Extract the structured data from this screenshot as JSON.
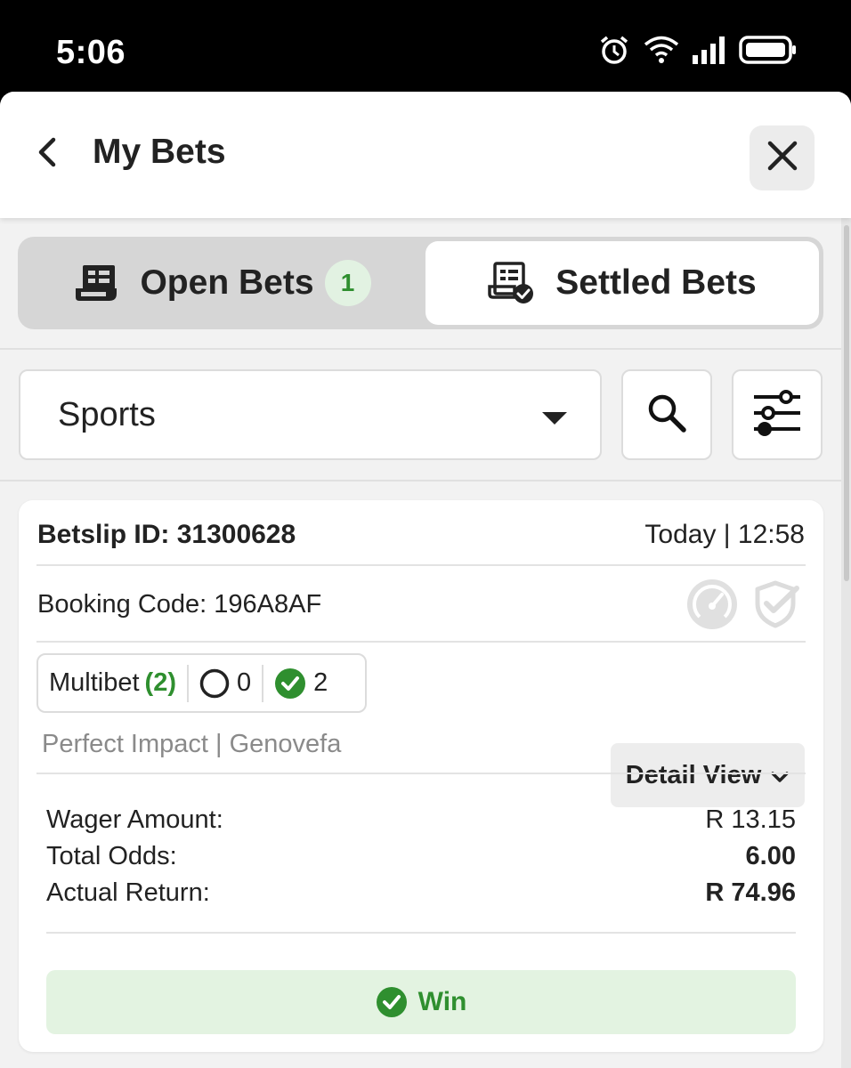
{
  "status_bar": {
    "time": "5:06",
    "icons": [
      "alarm-icon",
      "wifi-icon",
      "signal-icon",
      "battery-icon"
    ]
  },
  "header": {
    "title": "My Bets",
    "back_icon": "chevron-left-icon",
    "close_icon": "close-icon"
  },
  "tabs": [
    {
      "label": "Open Bets",
      "badge": "1",
      "icon": "receipt-icon",
      "active": false
    },
    {
      "label": "Settled Bets",
      "icon": "receipt-check-icon",
      "active": true
    }
  ],
  "filters": {
    "category": "Sports",
    "search_icon": "search-icon",
    "filter_icon": "sliders-icon"
  },
  "bet": {
    "betslip_label": "Betslip ID:",
    "betslip_id": "31300628",
    "time": "Today | 12:58",
    "booking_code": "Booking Code: 196A8AF",
    "status_icons": [
      "speedometer-icon",
      "shield-check-icon"
    ],
    "type_label": "Multibet",
    "type_count": "(2)",
    "open_count": "0",
    "won_count": "2",
    "detail_view_label": "Detail View",
    "events": "Perfect Impact | Genovefa",
    "summary": [
      {
        "label": "Wager Amount:",
        "value": "R 13.15",
        "bold": false
      },
      {
        "label": "Total Odds:",
        "value": "6.00",
        "bold": true
      },
      {
        "label": "Actual Return:",
        "value": "R 74.96",
        "bold": true
      }
    ],
    "result": "Win"
  },
  "colors": {
    "accent_green": "#2f8f2f",
    "win_background": "#e3f3e1",
    "badge_background": "#e2f2e2"
  }
}
